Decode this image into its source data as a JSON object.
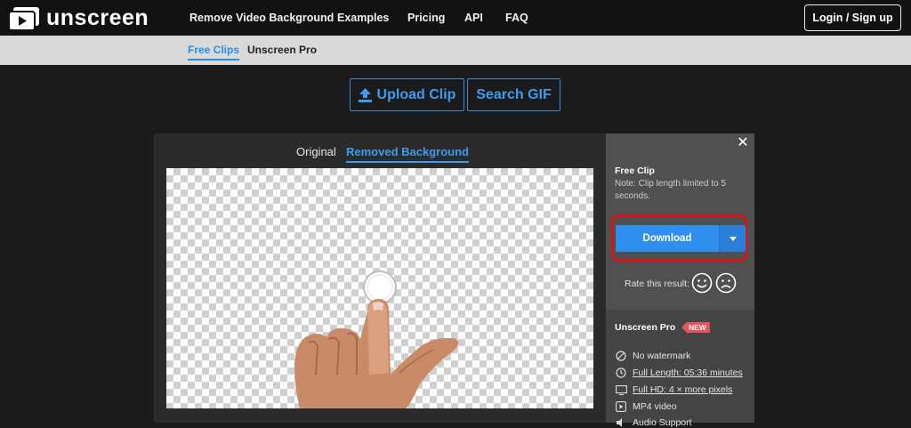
{
  "brand": {
    "name": "unscreen"
  },
  "nav": {
    "items": [
      "Remove Video Background",
      "Examples",
      "Pricing",
      "API",
      "FAQ"
    ],
    "login": "Login / Sign up"
  },
  "subnav": {
    "tabs": [
      "Free Clips",
      "Unscreen Pro"
    ],
    "active": "Free Clips"
  },
  "actions": {
    "upload": "Upload Clip",
    "search": "Search GIF"
  },
  "preview": {
    "tabs": [
      "Original",
      "Removed Background"
    ],
    "active": "Removed Background"
  },
  "side": {
    "free_title": "Free Clip",
    "note": "Note: Clip length limited to 5 seconds.",
    "download": "Download",
    "rate_label": "Rate this result:",
    "pro_title": "Unscreen Pro",
    "new_badge": "NEW",
    "features": [
      {
        "text": "No watermark",
        "icon": "no-watermark-icon"
      },
      {
        "text": "Full Length: 05:36 minutes",
        "icon": "clock-icon"
      },
      {
        "text": "Full HD: 4 × more pixels",
        "icon": "hd-icon"
      },
      {
        "text": "MP4 video",
        "icon": "play-icon"
      },
      {
        "text": "Audio Support",
        "icon": "audio-icon"
      }
    ]
  },
  "colors": {
    "accent": "#3c9cf0",
    "download": "#2f8fee",
    "highlight": "#d8141b",
    "badge": "#e8525a"
  }
}
